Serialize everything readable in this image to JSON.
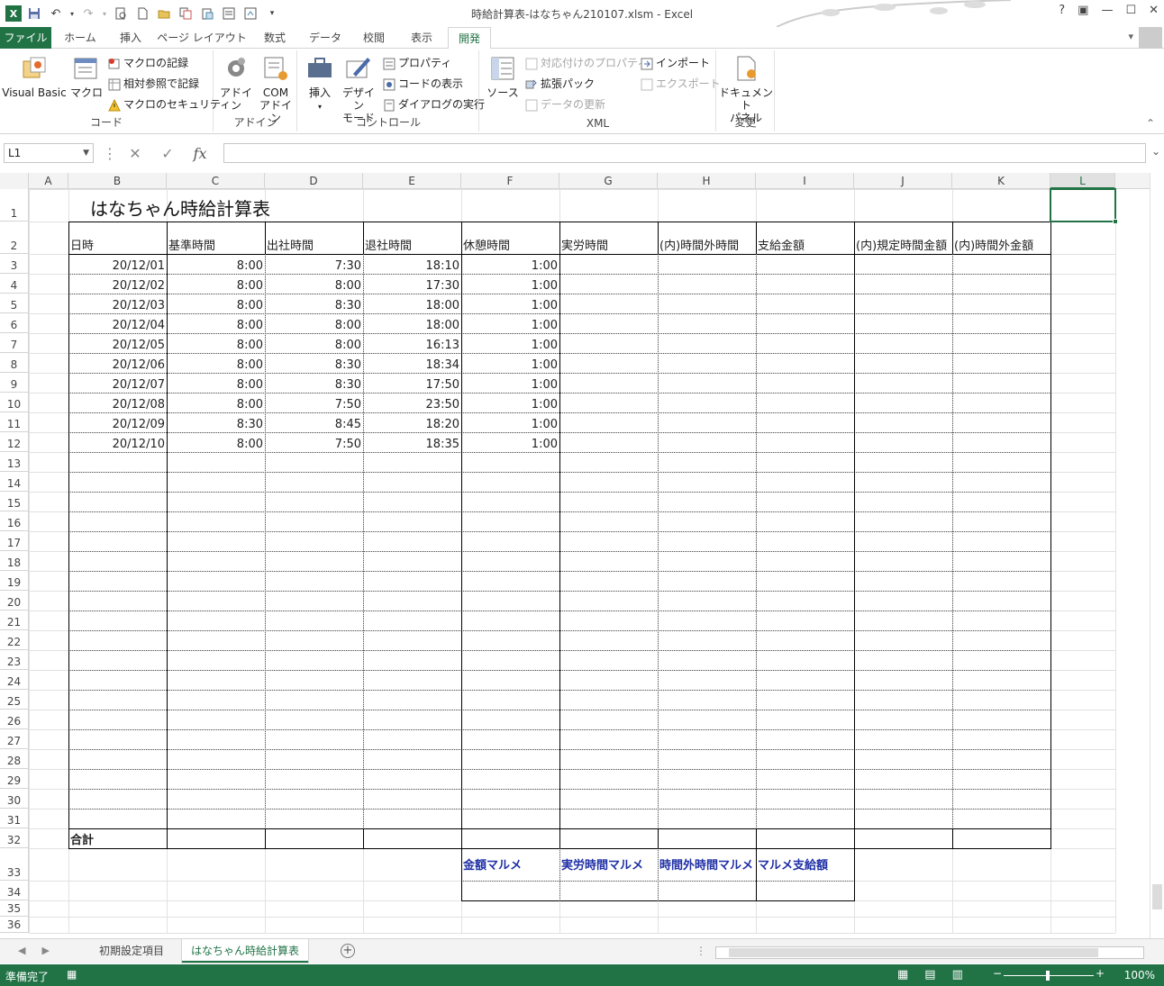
{
  "window": {
    "title": "時給計算表-はなちゃん210107.xlsm - Excel"
  },
  "qat": {
    "logo": "X",
    "save_icon": "save-icon",
    "undo_icon": "undo-icon",
    "redo_icon": "redo-icon"
  },
  "window_controls": {
    "help": "?",
    "restore_ribbon": "▣",
    "minimize": "—",
    "maximize": "☐",
    "close": "✕"
  },
  "tabs": [
    {
      "label": "ファイル"
    },
    {
      "label": "ホーム"
    },
    {
      "label": "挿入"
    },
    {
      "label": "ページ レイアウト"
    },
    {
      "label": "数式"
    },
    {
      "label": "データ"
    },
    {
      "label": "校閲"
    },
    {
      "label": "表示"
    },
    {
      "label": "開発"
    }
  ],
  "active_tab": "開発",
  "ribbon": {
    "code": {
      "label": "コード",
      "visual_basic": "Visual Basic",
      "macro": "マクロ",
      "record_macro": "マクロの記録",
      "relative_ref": "相対参照で記録",
      "macro_security": "マクロのセキュリティ"
    },
    "addins": {
      "label": "アドイン",
      "addin": "アドイン",
      "com_addin_1": "COM",
      "com_addin_2": "アドイン"
    },
    "controls": {
      "label": "コントロール",
      "insert": "挿入",
      "design_1": "デザイン",
      "design_2": "モード",
      "properties": "プロパティ",
      "view_code": "コードの表示",
      "run_dialog": "ダイアログの実行"
    },
    "xml": {
      "label": "XML",
      "source": "ソース",
      "map_properties": "対応付けのプロパティ",
      "expansion_packs": "拡張パック",
      "refresh_data": "データの更新",
      "import": "インポート",
      "export": "エクスポート"
    },
    "modify": {
      "label": "変更",
      "doc_panel_1": "ドキュメント",
      "doc_panel_2": "パネル"
    }
  },
  "formula_bar": {
    "name_box": "L1",
    "cancel": "✕",
    "enter": "✓",
    "fx": "fx",
    "value": ""
  },
  "columns": [
    "A",
    "B",
    "C",
    "D",
    "E",
    "F",
    "G",
    "H",
    "I",
    "J",
    "K",
    "L"
  ],
  "selected_column": "L",
  "rows": [
    "1",
    "2",
    "3",
    "4",
    "5",
    "6",
    "7",
    "8",
    "9",
    "10",
    "11",
    "12",
    "13",
    "14",
    "15",
    "16",
    "17",
    "18",
    "19",
    "20",
    "21",
    "22",
    "23",
    "24",
    "25",
    "26",
    "27",
    "28",
    "29",
    "30",
    "31",
    "32",
    "33",
    "34",
    "35",
    "36"
  ],
  "sheet": {
    "title": "はなちゃん時給計算表",
    "headers": [
      "日時",
      "基準時間",
      "出社時間",
      "退社時間",
      "休憩時間",
      "実労時間",
      "(内)時間外時間",
      "支給金額",
      "(内)規定時間金額",
      "(内)時間外金額"
    ],
    "data": [
      [
        "20/12/01",
        "8:00",
        "7:30",
        "18:10",
        "1:00"
      ],
      [
        "20/12/02",
        "8:00",
        "8:00",
        "17:30",
        "1:00"
      ],
      [
        "20/12/03",
        "8:00",
        "8:30",
        "18:00",
        "1:00"
      ],
      [
        "20/12/04",
        "8:00",
        "8:00",
        "18:00",
        "1:00"
      ],
      [
        "20/12/05",
        "8:00",
        "8:00",
        "16:13",
        "1:00"
      ],
      [
        "20/12/06",
        "8:00",
        "8:30",
        "18:34",
        "1:00"
      ],
      [
        "20/12/07",
        "8:00",
        "8:30",
        "17:50",
        "1:00"
      ],
      [
        "20/12/08",
        "8:00",
        "7:50",
        "23:50",
        "1:00"
      ],
      [
        "20/12/09",
        "8:30",
        "8:45",
        "18:20",
        "1:00"
      ],
      [
        "20/12/10",
        "8:00",
        "7:50",
        "18:35",
        "1:00"
      ]
    ],
    "total_label": "合計",
    "summary_headers": [
      "金額マルメ",
      "実労時間マルメ",
      "時間外時間マルメ",
      "マルメ支給額"
    ]
  },
  "sheet_tabs": [
    {
      "label": "初期設定項目"
    },
    {
      "label": "はなちゃん時給計算表"
    }
  ],
  "active_sheet": "はなちゃん時給計算表",
  "status": {
    "ready": "準備完了",
    "zoom": "100%",
    "zoom_minus": "−",
    "zoom_plus": "+"
  },
  "colors": {
    "accent": "#217346",
    "summary_text": "#1f2fa5"
  }
}
